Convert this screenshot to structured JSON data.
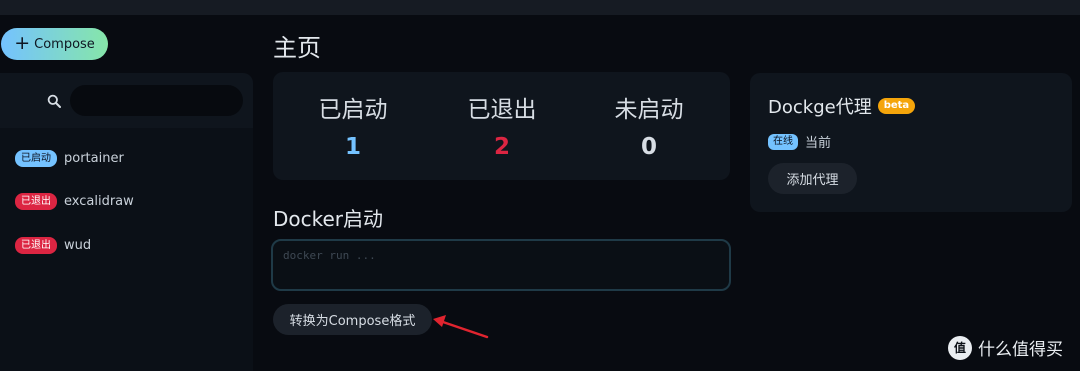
{
  "compose_button": {
    "label": "Compose"
  },
  "sidebar": {
    "search": {
      "placeholder": ""
    },
    "stacks": [
      {
        "status": "已启动",
        "name": "portainer"
      },
      {
        "status": "已退出",
        "name": "excalidraw"
      },
      {
        "status": "已退出",
        "name": "wud"
      }
    ]
  },
  "main": {
    "title": "主页",
    "stats": [
      {
        "label": "已启动",
        "value": "1",
        "color": "#74c2ff"
      },
      {
        "label": "已退出",
        "value": "2",
        "color": "#dc2542"
      },
      {
        "label": "未启动",
        "value": "0",
        "color": "#d7dde4"
      }
    ],
    "docker_run": {
      "title": "Docker启动",
      "placeholder": "docker run ...",
      "convert_label": "转换为Compose格式"
    }
  },
  "agent": {
    "title": "Dockge代理",
    "beta": "beta",
    "status": "在线",
    "current": "当前",
    "add_label": "添加代理"
  },
  "watermark": {
    "logo": "值",
    "text": "什么值得买"
  }
}
